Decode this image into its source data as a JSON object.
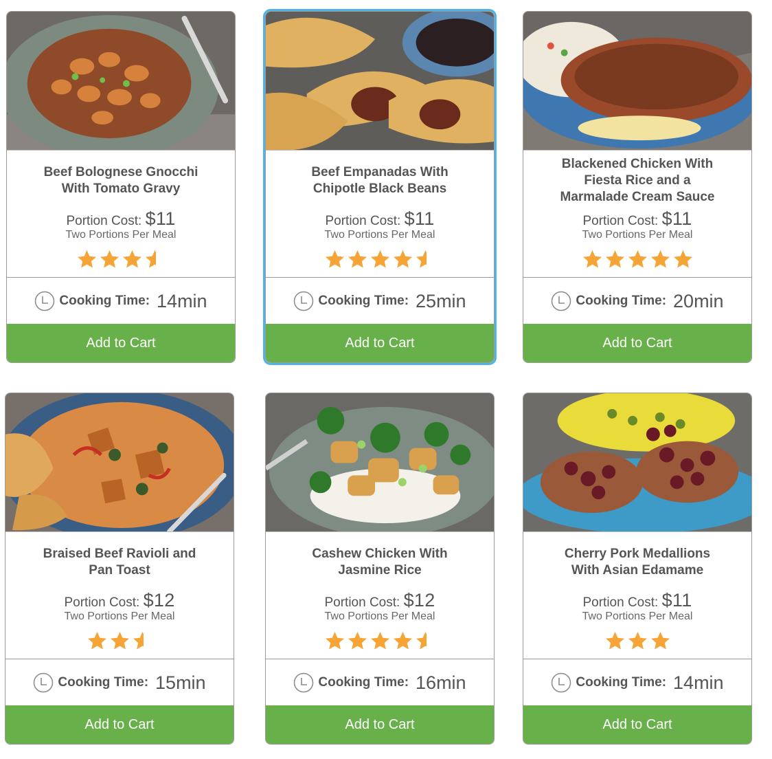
{
  "labels": {
    "portion_cost": "Portion Cost:",
    "cooking_time": "Cooking Time:",
    "add_to_cart": "Add to Cart"
  },
  "meals": [
    {
      "title_line1": "Beef Bolognese Gnocchi",
      "title_line2": "With Tomato Gravy",
      "title_line3": "",
      "price": "$11",
      "portions": "Two Portions Per Meal",
      "rating": 3.5,
      "time": "14min",
      "selected": false,
      "photo": "gnocchi-photo",
      "plate_color": "#7c8a80",
      "food_color": "#d6823c"
    },
    {
      "title_line1": "Beef Empanadas With",
      "title_line2": "Chipotle Black Beans",
      "title_line3": "",
      "price": "$11",
      "portions": "Two Portions Per Meal",
      "rating": 4.5,
      "time": "25min",
      "selected": true,
      "photo": "empanadas-photo",
      "plate_color": "#5b86b0",
      "food_color": "#e0b160"
    },
    {
      "title_line1": "Blackened Chicken With",
      "title_line2": "Fiesta Rice and a",
      "title_line3": "Marmalade Cream Sauce",
      "price": "$11",
      "portions": "Two Portions Per Meal",
      "rating": 5,
      "time": "20min",
      "selected": false,
      "photo": "blackened-chicken-photo",
      "plate_color": "#3f78b0",
      "food_color": "#9a4a2a"
    },
    {
      "title_line1": "Braised Beef Ravioli and",
      "title_line2": "Pan Toast",
      "title_line3": "",
      "price": "$12",
      "portions": "Two Portions Per Meal",
      "rating": 2.5,
      "time": "15min",
      "selected": false,
      "photo": "ravioli-photo",
      "plate_color": "#3a5d85",
      "food_color": "#d98a45"
    },
    {
      "title_line1": "Cashew Chicken With",
      "title_line2": "Jasmine Rice",
      "title_line3": "",
      "price": "$12",
      "portions": "Two Portions Per Meal",
      "rating": 4.5,
      "time": "16min",
      "selected": false,
      "photo": "cashew-chicken-photo",
      "plate_color": "#7e8c84",
      "food_color": "#d9a04e"
    },
    {
      "title_line1": "Cherry Pork Medallions",
      "title_line2": "With Asian Edamame",
      "title_line3": "",
      "price": "$11",
      "portions": "Two Portions Per Meal",
      "rating": 3,
      "time": "14min",
      "selected": false,
      "photo": "cherry-pork-photo",
      "plate_color": "#3e9bc7",
      "food_color": "#6a1a26"
    }
  ],
  "colors": {
    "star": "#f7a437",
    "button": "#68b04a",
    "selected_border": "#4fb3ea",
    "text": "#555555"
  }
}
